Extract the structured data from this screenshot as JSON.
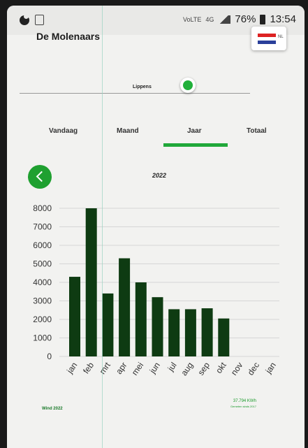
{
  "status_bar": {
    "battery_percent": "76%",
    "time": "13:54",
    "network_small_1": "VoLTE",
    "network_small_2": "4G"
  },
  "header": {
    "station_name": "De Molenaars",
    "slider_label": "Lippens",
    "language_label": "NL"
  },
  "tabs": [
    {
      "label": "Vandaag"
    },
    {
      "label": "Maand"
    },
    {
      "label": "Jaar"
    },
    {
      "label": "Totaal"
    }
  ],
  "active_tab": "Jaar",
  "year_title": "2022",
  "legend": {
    "left": "Wind 2022",
    "right_value": "37.794 KWh",
    "right_note": "Gemeten sinds 2017"
  },
  "colors": {
    "bar": "#0e3b12",
    "accent": "#21a83a",
    "background": "#f2f2f0"
  },
  "chart_data": {
    "type": "bar",
    "categories": [
      "jan",
      "feb",
      "mrt",
      "apr",
      "mei",
      "jun",
      "jul",
      "aug",
      "sep",
      "okt",
      "nov",
      "dec",
      "jan"
    ],
    "values": [
      4300,
      8000,
      3400,
      5300,
      4000,
      3200,
      2550,
      2550,
      2600,
      2050,
      0,
      0,
      0
    ],
    "title": "2022",
    "ylim": [
      0,
      8000
    ],
    "yticks": [
      0,
      1000,
      2000,
      3000,
      4000,
      5000,
      6000,
      7000,
      8000
    ],
    "grid": true
  }
}
